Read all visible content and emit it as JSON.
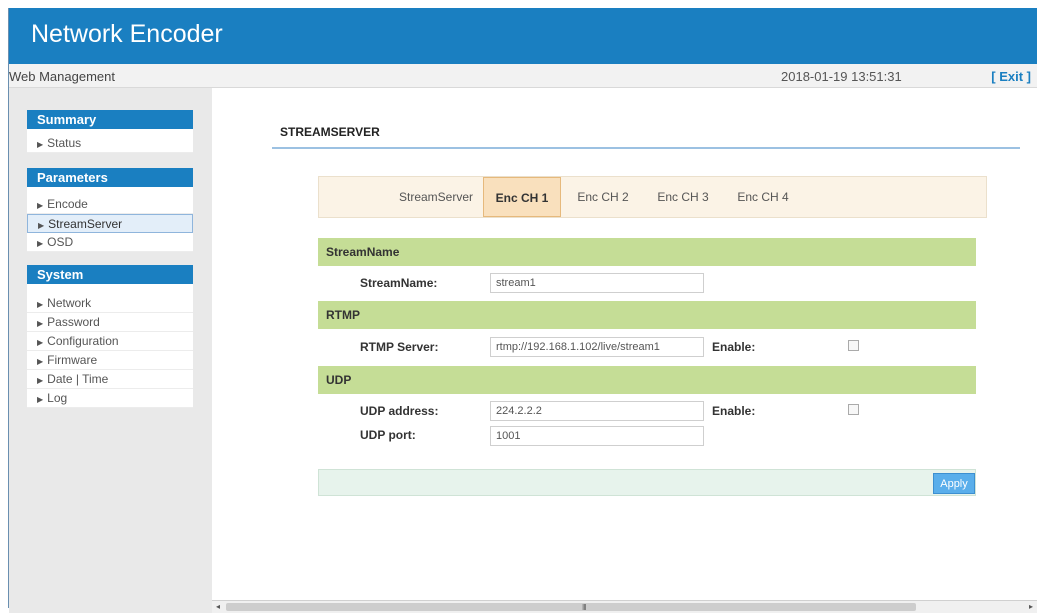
{
  "header": {
    "title": "Network Encoder",
    "subtitle": "Web Management",
    "datetime": "2018-01-19 13:51:31",
    "exit_label": "[ Exit ]"
  },
  "sidebar": {
    "sections": [
      {
        "title": "Summary",
        "items": [
          "Status"
        ]
      },
      {
        "title": "Parameters",
        "items": [
          "Encode",
          "StreamServer",
          "OSD"
        ]
      },
      {
        "title": "System",
        "items": [
          "Network",
          "Password",
          "Configuration",
          "Firmware",
          "Date | Time",
          "Log"
        ]
      }
    ],
    "active_item": "StreamServer"
  },
  "page": {
    "title": "STREAMSERVER",
    "tabs": [
      "StreamServer",
      "Enc CH 1",
      "Enc CH 2",
      "Enc CH 3",
      "Enc CH 4"
    ],
    "active_tab": "Enc CH 1"
  },
  "sections": {
    "streamname": {
      "title": "StreamName",
      "label": "StreamName:",
      "value": "stream1"
    },
    "rtmp": {
      "title": "RTMP",
      "server_label": "RTMP Server:",
      "server_value": "rtmp://192.168.1.102/live/stream1",
      "enable_label": "Enable:",
      "enabled": false
    },
    "udp": {
      "title": "UDP",
      "address_label": "UDP address:",
      "address_value": "224.2.2.2",
      "port_label": "UDP port:",
      "port_value": "1001",
      "enable_label": "Enable:",
      "enabled": false
    }
  },
  "actions": {
    "apply_label": "Apply"
  },
  "scrollbar": {
    "left_arrow": "◂",
    "right_arrow": "▸",
    "grip": "III"
  },
  "colors": {
    "brand_blue": "#1a7fc1",
    "section_green": "#c5dd96",
    "tab_active": "#f9e0bd",
    "apply_button": "#5aaeeb"
  }
}
